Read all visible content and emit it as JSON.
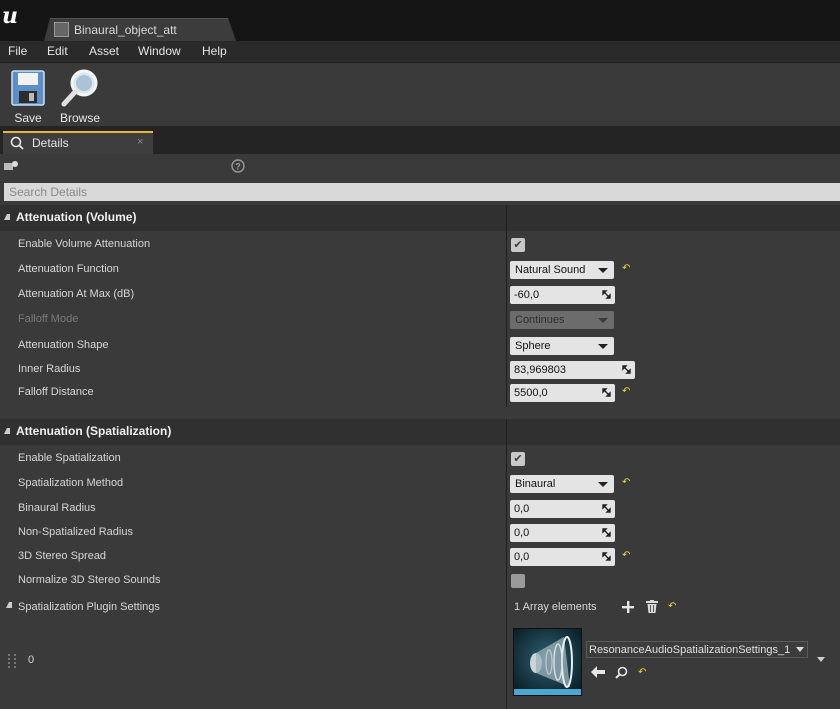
{
  "window": {
    "tab_title": "Binaural_object_att"
  },
  "menu": {
    "items": [
      "File",
      "Edit",
      "Asset",
      "Window",
      "Help"
    ]
  },
  "toolbar": {
    "save_label": "Save",
    "browse_label": "Browse"
  },
  "details_tab": {
    "label": "Details",
    "close": "×"
  },
  "search": {
    "placeholder": "Search Details"
  },
  "volume": {
    "title": "Attenuation (Volume)",
    "enable_volume_attenuation": {
      "label": "Enable Volume Attenuation",
      "checked": true
    },
    "attenuation_function": {
      "label": "Attenuation Function",
      "value": "Natural Sound"
    },
    "attenuation_at_max": {
      "label": "Attenuation At Max (dB)",
      "value": "-60,0"
    },
    "falloff_mode": {
      "label": "Falloff Mode",
      "value": "Continues"
    },
    "attenuation_shape": {
      "label": "Attenuation Shape",
      "value": "Sphere"
    },
    "inner_radius": {
      "label": "Inner Radius",
      "value": "83,969803"
    },
    "falloff_distance": {
      "label": "Falloff Distance",
      "value": "5500,0"
    }
  },
  "spatialization": {
    "title": "Attenuation (Spatialization)",
    "enable_spatialization": {
      "label": "Enable Spatialization",
      "checked": true
    },
    "spatialization_method": {
      "label": "Spatialization Method",
      "value": "Binaural"
    },
    "binaural_radius": {
      "label": "Binaural Radius",
      "value": "0,0"
    },
    "non_spatialized_radius": {
      "label": "Non-Spatialized Radius",
      "value": "0,0"
    },
    "stereo_spread": {
      "label": "3D Stereo Spread",
      "value": "0,0"
    },
    "normalize_3d_stereo": {
      "label": "Normalize 3D Stereo Sounds",
      "checked": false
    },
    "plugin_settings": {
      "label": "Spatialization Plugin Settings",
      "count_text": "1 Array elements",
      "element_index": "0",
      "asset_name": "ResonanceAudioSpatializationSettings_1"
    }
  },
  "colors": {
    "accent_tab": "#e8b43c",
    "reset_arrow": "#e8d24a"
  }
}
